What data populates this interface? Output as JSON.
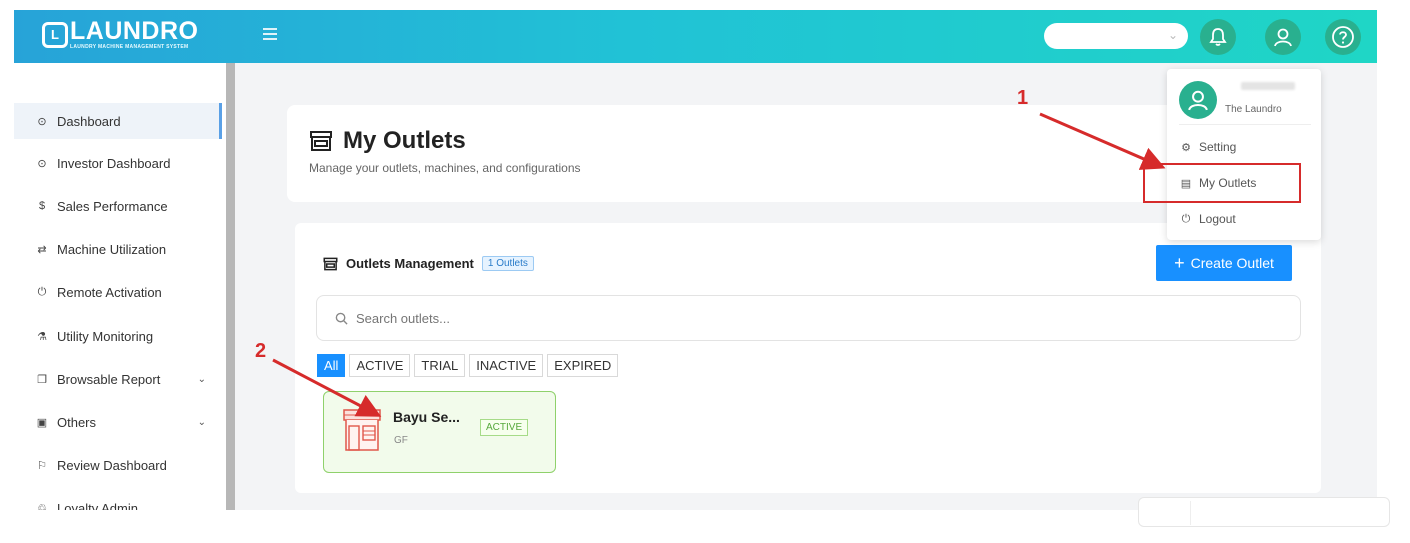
{
  "brand": {
    "logo_letter": "L",
    "name": "LAUNDRO",
    "tagline": "LAUNDRY MACHINE MANAGEMENT SYSTEM"
  },
  "header": {
    "outlet_selector_value": "",
    "icons": [
      "menu-icon",
      "bell-icon",
      "user-icon",
      "help-icon"
    ]
  },
  "sidebar": {
    "items": [
      {
        "label": "Dashboard",
        "icon": "dashboard-icon",
        "glyph": "⊙"
      },
      {
        "label": "Investor Dashboard",
        "icon": "dashboard-icon",
        "glyph": "⊙"
      },
      {
        "label": "Sales Performance",
        "icon": "dollar-icon",
        "glyph": "$"
      },
      {
        "label": "Machine Utilization",
        "icon": "swap-icon",
        "glyph": "⇄"
      },
      {
        "label": "Remote Activation",
        "icon": "power-icon",
        "glyph": "⏻"
      },
      {
        "label": "Utility Monitoring",
        "icon": "flask-icon",
        "glyph": "⚗"
      },
      {
        "label": "Browsable Report",
        "icon": "copy-icon",
        "glyph": "❐"
      },
      {
        "label": "Others",
        "icon": "folder-icon",
        "glyph": "▣"
      },
      {
        "label": "Review Dashboard",
        "icon": "review-icon",
        "glyph": "⚐"
      },
      {
        "label": "Loyalty Admin",
        "icon": "loyalty-icon",
        "glyph": "♲"
      }
    ]
  },
  "page": {
    "title": "My Outlets",
    "subtitle": "Manage your outlets, machines, and configurations"
  },
  "management": {
    "title": "Outlets Management",
    "count_badge": "1 Outlets",
    "create_label": "Create Outlet",
    "search_placeholder": "Search outlets...",
    "filters": [
      "All",
      "ACTIVE",
      "TRIAL",
      "INACTIVE",
      "EXPIRED"
    ],
    "selected_filter": "All"
  },
  "outlet": {
    "name": "Bayu Se...",
    "code": "GF",
    "status": "ACTIVE"
  },
  "user_menu": {
    "company": "The Laundro",
    "items": [
      {
        "label": "Setting",
        "icon": "gear-icon"
      },
      {
        "label": "My Outlets",
        "icon": "store-icon"
      },
      {
        "label": "Logout",
        "icon": "power-icon"
      }
    ]
  },
  "annotations": {
    "step1": "1",
    "step2": "2"
  },
  "colors": {
    "header_start": "#27a3d8",
    "header_end": "#1fd6c6",
    "accent_green": "#29b08f",
    "primary_blue": "#1890ff",
    "annotation_red": "#d62b2b"
  }
}
